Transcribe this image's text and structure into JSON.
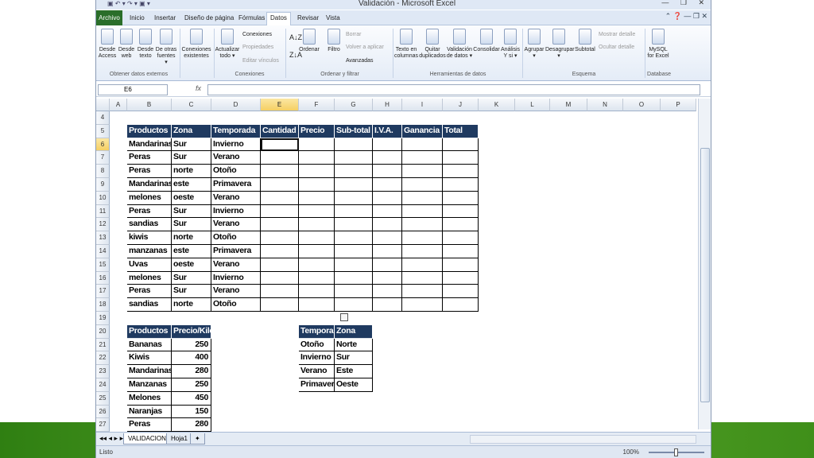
{
  "window": {
    "title": "Validación - Microsoft Excel",
    "quick_access": "▣ ↶ ▾ ↷ ▾ ▣ ▾"
  },
  "tabs": [
    {
      "label": "Archivo"
    },
    {
      "label": "Inicio"
    },
    {
      "label": "Insertar"
    },
    {
      "label": "Diseño de página"
    },
    {
      "label": "Fórmulas"
    },
    {
      "label": "Datos"
    },
    {
      "label": "Revisar"
    },
    {
      "label": "Vista"
    }
  ],
  "ribbon": {
    "buttons": [
      {
        "l1": "Desde",
        "l2": "Access"
      },
      {
        "l1": "Desde",
        "l2": "web"
      },
      {
        "l1": "Desde",
        "l2": "texto"
      },
      {
        "l1": "De otras",
        "l2": "fuentes ▾"
      },
      {
        "l1": "Conexiones",
        "l2": "existentes"
      },
      {
        "l1": "Actualizar",
        "l2": "todo ▾"
      },
      {
        "l1": "Ordenar",
        "l2": ""
      },
      {
        "l1": "Filtro",
        "l2": ""
      },
      {
        "l1": "Texto en",
        "l2": "columnas"
      },
      {
        "l1": "Quitar",
        "l2": "duplicados"
      },
      {
        "l1": "Validación",
        "l2": "de datos ▾"
      },
      {
        "l1": "Consolidar",
        "l2": ""
      },
      {
        "l1": "Análisis",
        "l2": "Y si ▾"
      },
      {
        "l1": "Agrupar",
        "l2": "▾"
      },
      {
        "l1": "Desagrupar",
        "l2": "▾"
      },
      {
        "l1": "Subtotal",
        "l2": ""
      },
      {
        "l1": "MySQL",
        "l2": "for Excel"
      }
    ],
    "small": {
      "conexiones": "Conexiones",
      "propiedades": "Propiedades",
      "editar": "Editar vínculos",
      "borrar": "Borrar",
      "volver": "Volver a aplicar",
      "avanzadas": "Avanzadas",
      "mostrar": "Mostrar detalle",
      "ocultar": "Ocultar detalle"
    },
    "groups": {
      "externos": "Obtener datos externos",
      "conexiones": "Conexiones",
      "ordenar": "Ordenar y filtrar",
      "herramientas": "Herramientas de datos",
      "esquema": "Esquema",
      "database": "Database"
    }
  },
  "formula_bar": {
    "name_box": "E6",
    "fx": "fx",
    "value": ""
  },
  "columns": [
    "A",
    "B",
    "C",
    "D",
    "E",
    "F",
    "G",
    "H",
    "I",
    "J",
    "K",
    "L",
    "M",
    "N",
    "O",
    "P"
  ],
  "rows": [
    "4",
    "5",
    "6",
    "7",
    "8",
    "9",
    "10",
    "11",
    "12",
    "13",
    "14",
    "15",
    "16",
    "17",
    "18",
    "19",
    "20",
    "21",
    "22",
    "23",
    "24",
    "25",
    "26",
    "27"
  ],
  "table1": {
    "headers": [
      "Productos",
      "Zona",
      "Temporada",
      "Cantidad",
      "Precio",
      "Sub-total",
      "I.V.A.",
      "Ganancia",
      "Total"
    ],
    "rows": [
      [
        "Mandarinas",
        "Sur",
        "Invierno"
      ],
      [
        "Peras",
        "Sur",
        "Verano"
      ],
      [
        "Peras",
        "norte",
        "Otoño"
      ],
      [
        "Mandarinas",
        "este",
        "Primavera"
      ],
      [
        "melones",
        "oeste",
        "Verano"
      ],
      [
        "Peras",
        "Sur",
        "Invierno"
      ],
      [
        "sandias",
        "Sur",
        "Verano"
      ],
      [
        "kiwis",
        "norte",
        "Otoño"
      ],
      [
        "manzanas",
        "este",
        "Primavera"
      ],
      [
        "Uvas",
        "oeste",
        "Verano"
      ],
      [
        "melones",
        "Sur",
        "Invierno"
      ],
      [
        "Peras",
        "Sur",
        "Verano"
      ],
      [
        "sandias",
        "norte",
        "Otoño"
      ]
    ]
  },
  "table2": {
    "headers": [
      "Productos",
      "Precio/Kilo"
    ],
    "rows": [
      [
        "Bananas",
        "250"
      ],
      [
        "Kiwis",
        "400"
      ],
      [
        "Mandarinas",
        "280"
      ],
      [
        "Manzanas",
        "250"
      ],
      [
        "Melones",
        "450"
      ],
      [
        "Naranjas",
        "150"
      ],
      [
        "Peras",
        "280"
      ]
    ]
  },
  "table3": {
    "headers": [
      "Temporada",
      "Zona"
    ],
    "rows": [
      [
        "Otoño",
        "Norte"
      ],
      [
        "Invierno",
        "Sur"
      ],
      [
        "Verano",
        "Este"
      ],
      [
        "Primavera",
        "Oeste"
      ]
    ]
  },
  "sheets": [
    {
      "label": "VALIDACION"
    },
    {
      "label": "Hoja1"
    }
  ],
  "status": {
    "left": "Listo",
    "zoom": "100%"
  }
}
